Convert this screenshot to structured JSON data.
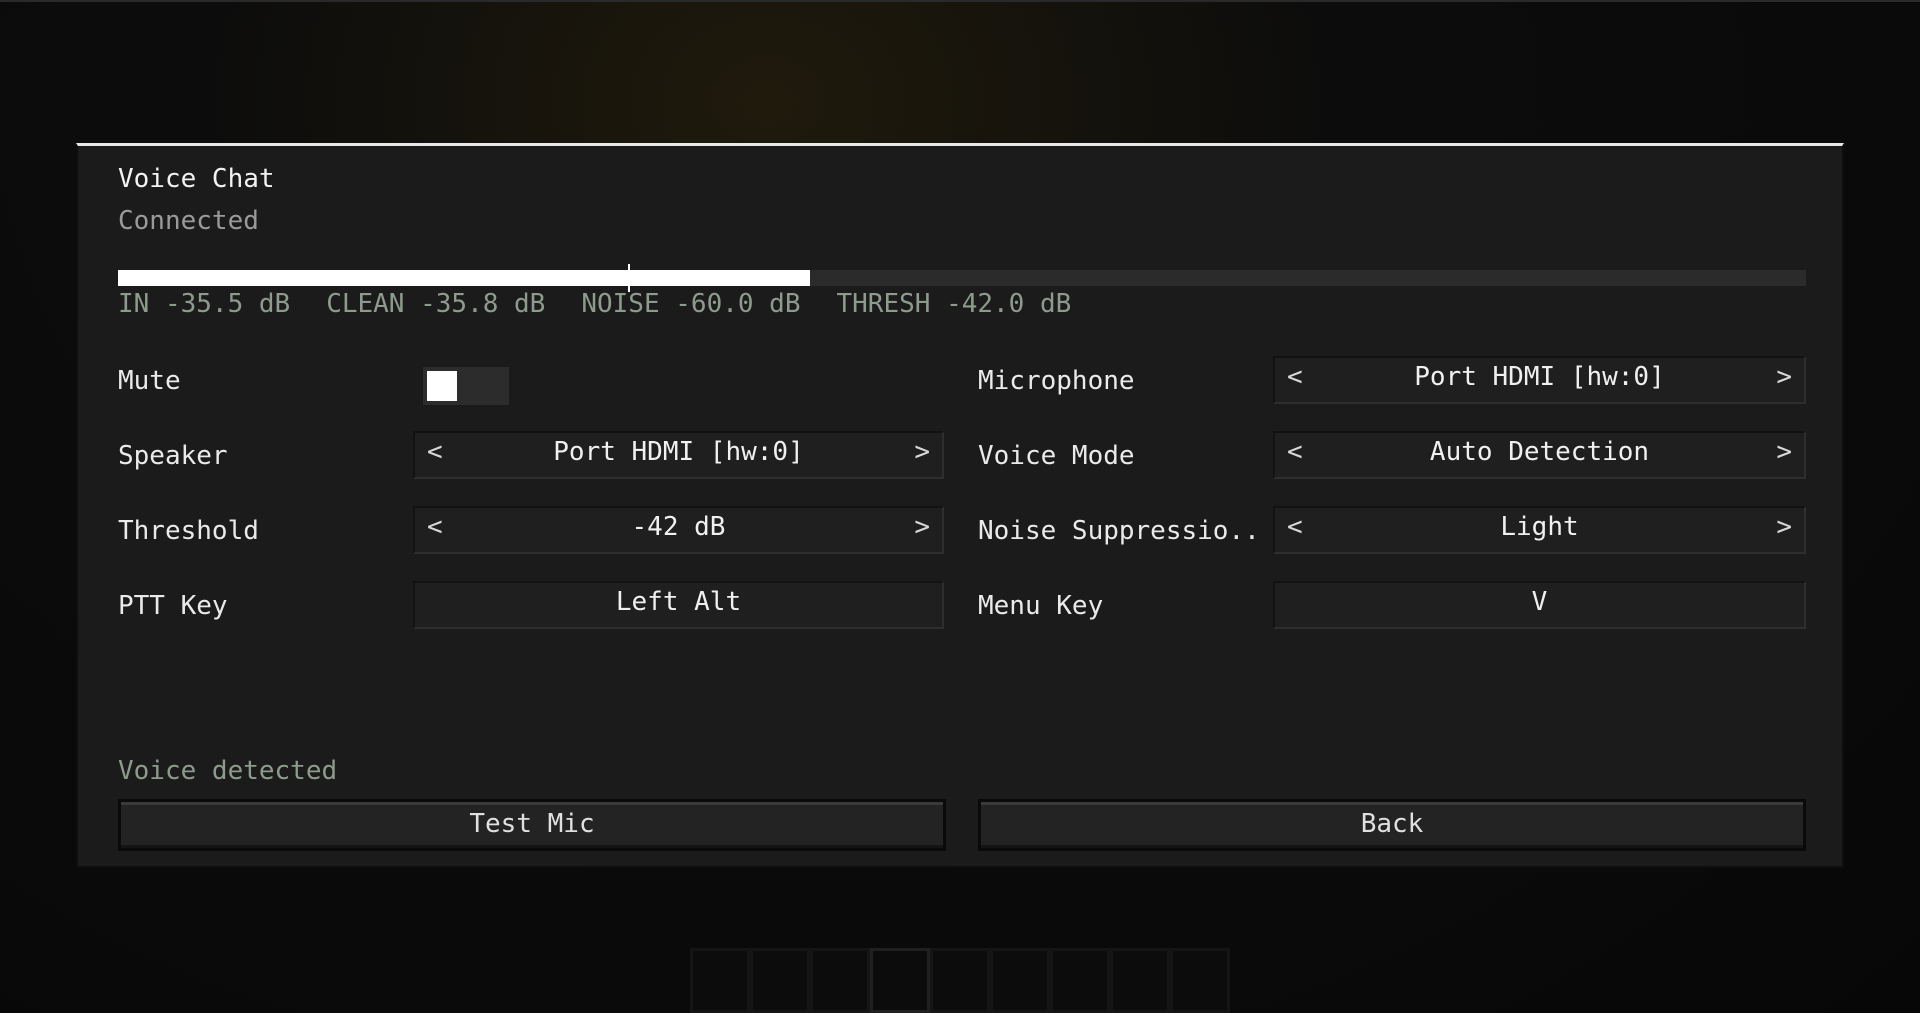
{
  "screen": {
    "title": "Voice Chat",
    "status": "Connected"
  },
  "meter": {
    "level_fraction": 0.41,
    "threshold_fraction": 0.302,
    "readouts": {
      "in": "IN -35.5 dB",
      "clean": "CLEAN -35.8 dB",
      "noise": "NOISE -60.0 dB",
      "thresh": "THRESH -42.0 dB"
    }
  },
  "settings": {
    "mute": {
      "label": "Mute",
      "enabled": false
    },
    "speaker": {
      "label": "Speaker",
      "value": "Port HDMI [hw:0]"
    },
    "threshold": {
      "label": "Threshold",
      "value": "-42 dB"
    },
    "ptt_key": {
      "label": "PTT Key",
      "value": "Left Alt"
    },
    "microphone": {
      "label": "Microphone",
      "value": "Port HDMI [hw:0]"
    },
    "voice_mode": {
      "label": "Voice Mode",
      "value": "Auto Detection"
    },
    "noise_suppression": {
      "label": "Noise Suppressio..",
      "value": "Light"
    },
    "menu_key": {
      "label": "Menu Key",
      "value": "V"
    }
  },
  "arrows": {
    "left": "<",
    "right": ">"
  },
  "footer": {
    "voice_status": "Voice detected",
    "test_mic_label": "Test Mic",
    "back_label": "Back"
  },
  "colors": {
    "panel_bg": "#1b1b1b",
    "meter_fill": "#ffffff",
    "muted_green": "#8d9b8d"
  },
  "icons": {
    "prev": "chevron-left-icon",
    "next": "chevron-right-icon"
  }
}
